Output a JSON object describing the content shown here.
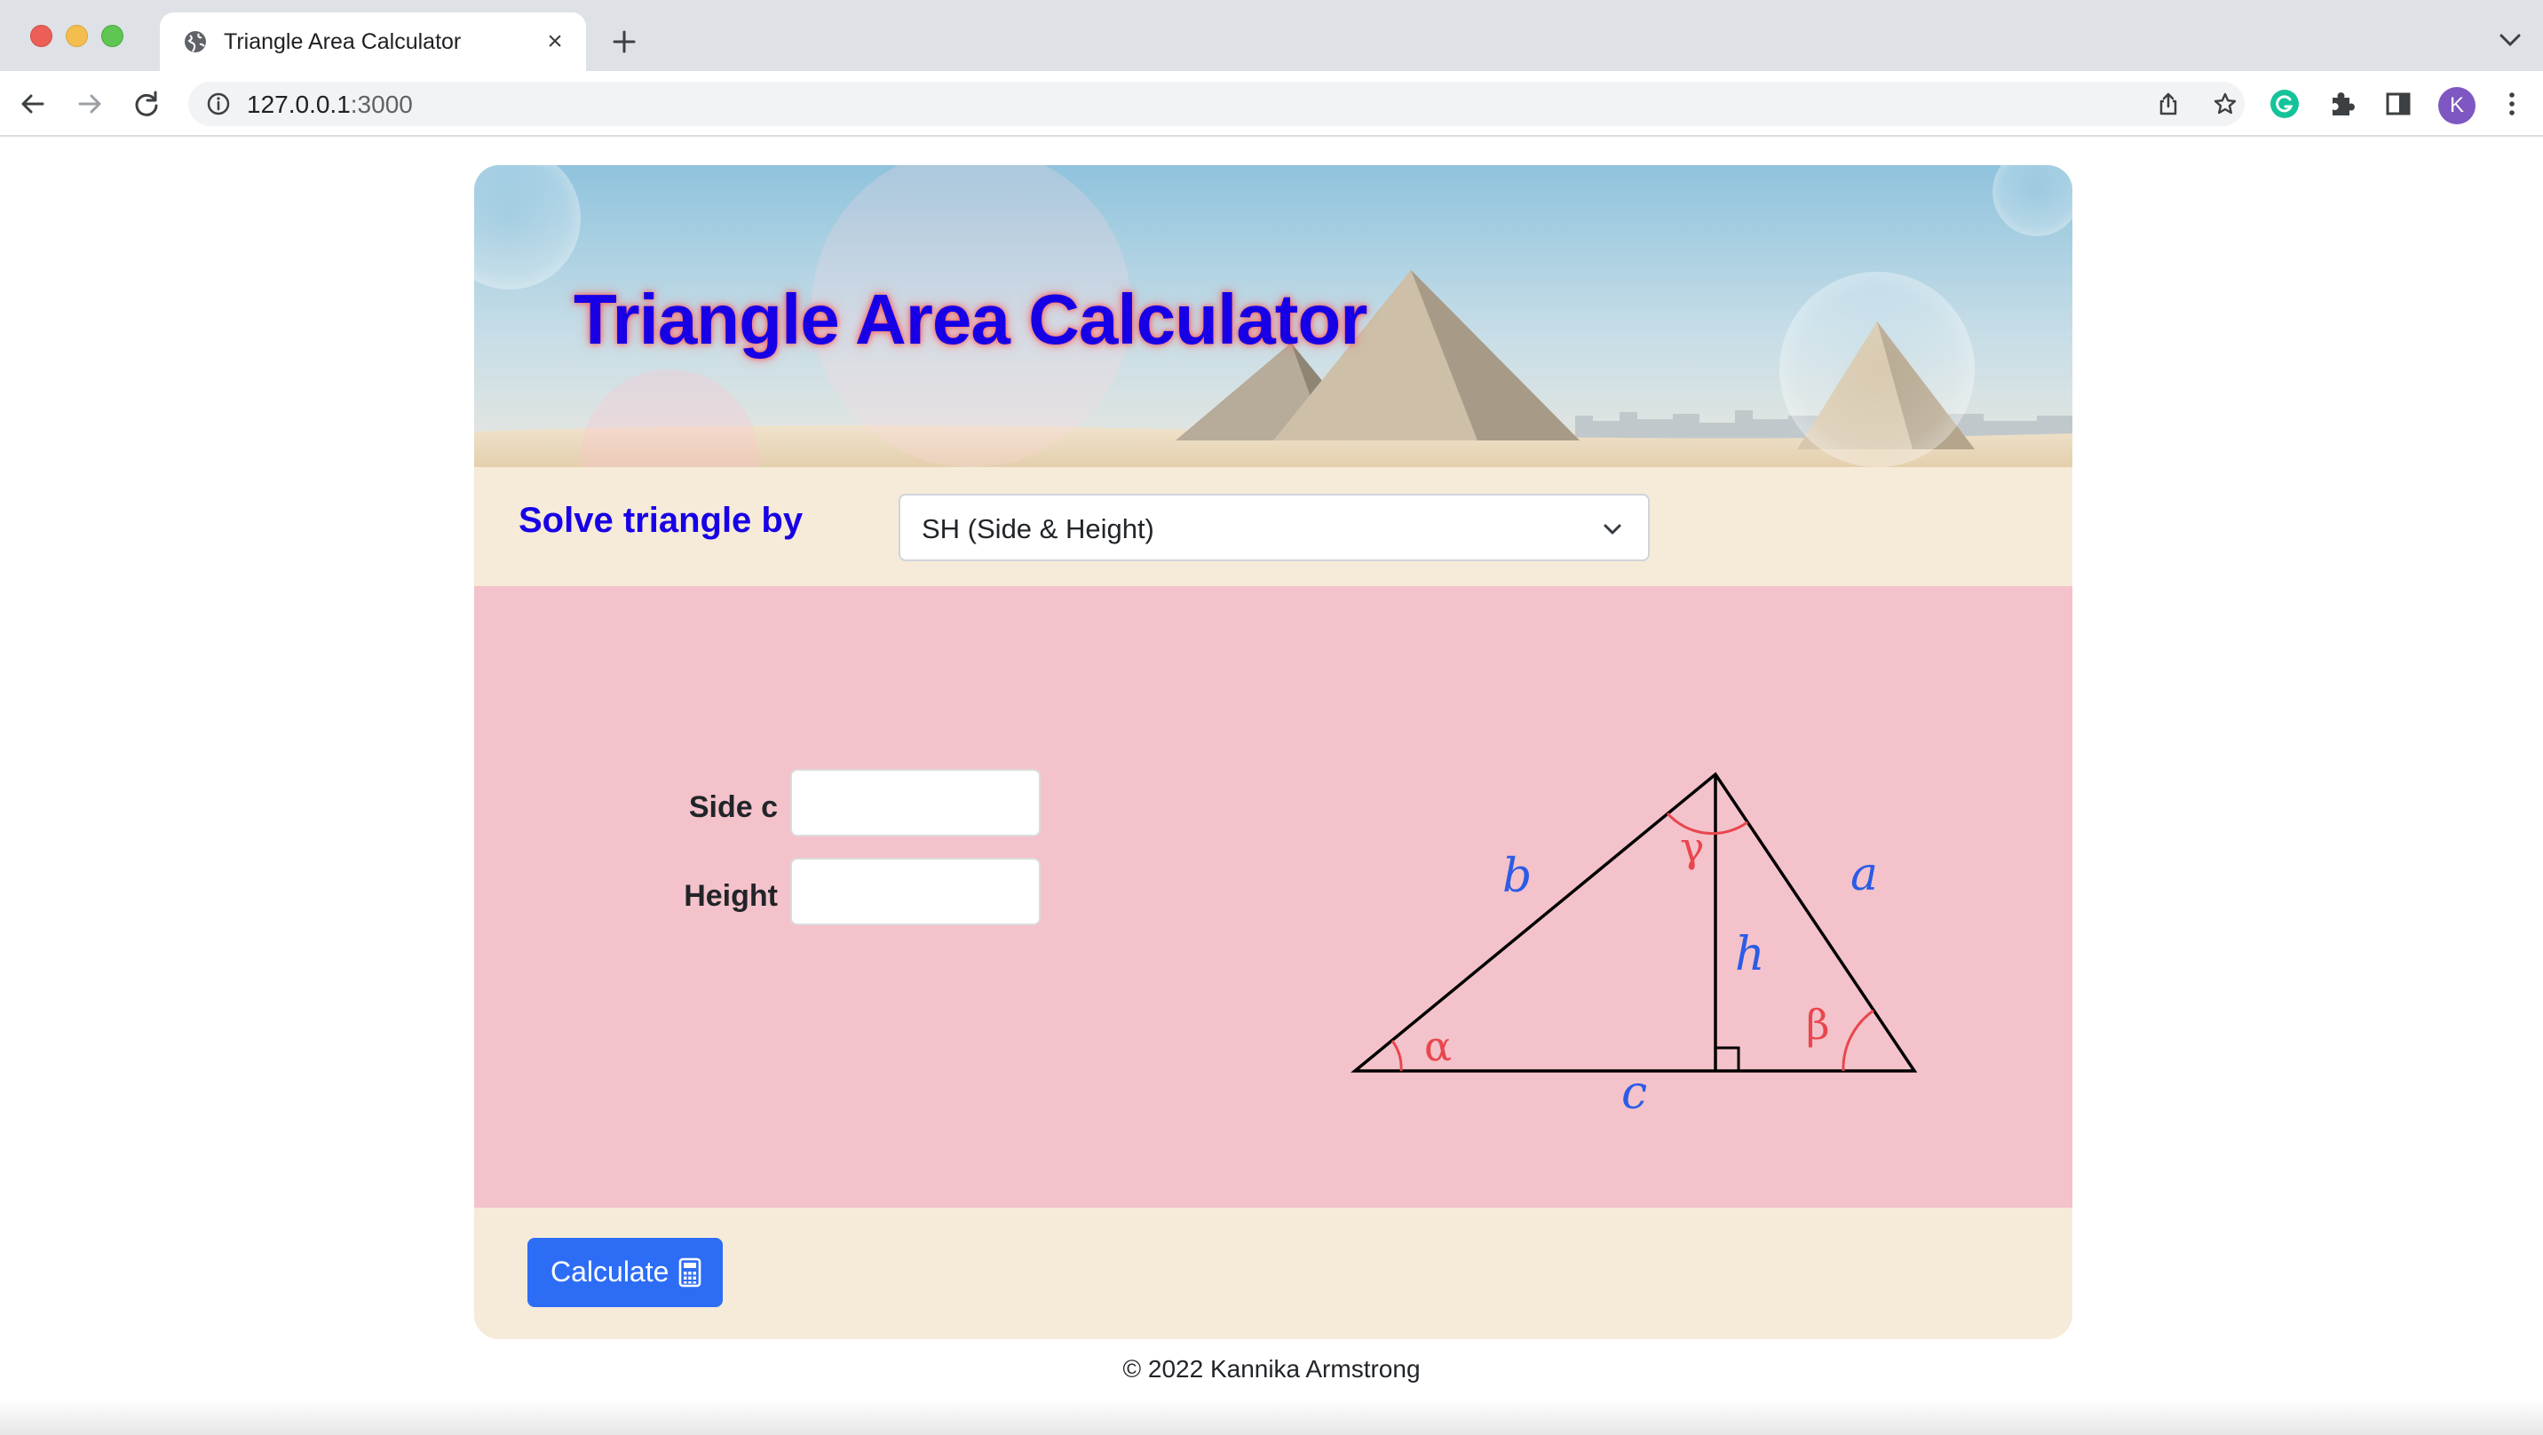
{
  "browser": {
    "tab_title": "Triangle Area Calculator",
    "tab_close": "×",
    "url_host": "127.0.0.1",
    "url_port": ":3000",
    "profile_initial": "K"
  },
  "page": {
    "title": "Triangle Area Calculator",
    "solve_label": "Solve triangle by",
    "method_select": {
      "value": "SH (Side & Height)"
    },
    "fields": [
      {
        "label": "Side c",
        "value": ""
      },
      {
        "label": "Height",
        "value": ""
      }
    ],
    "diagram_labels": {
      "side_a": "a",
      "side_b": "b",
      "side_c": "c",
      "height": "h",
      "angle_alpha": "α",
      "angle_beta": "β",
      "angle_gamma": "γ"
    },
    "calculate_button": "Calculate",
    "footer": "© 2022 Kannika Armstrong"
  },
  "colors": {
    "title": "#1700e6",
    "card_background": "#f6ead8",
    "input_panel": "#f4c2ca",
    "button": "#2d6df6",
    "side_labels": "#2b5ce6",
    "angle_labels": "#e8474d"
  },
  "icons": [
    "globe-icon",
    "close-icon",
    "plus-icon",
    "back-arrow-icon",
    "forward-arrow-icon",
    "reload-icon",
    "info-icon",
    "share-icon",
    "star-icon",
    "grammarly-icon",
    "puzzle-icon",
    "sidepanel-icon",
    "menu-dots-icon",
    "chevron-down-icon",
    "calculator-icon"
  ]
}
